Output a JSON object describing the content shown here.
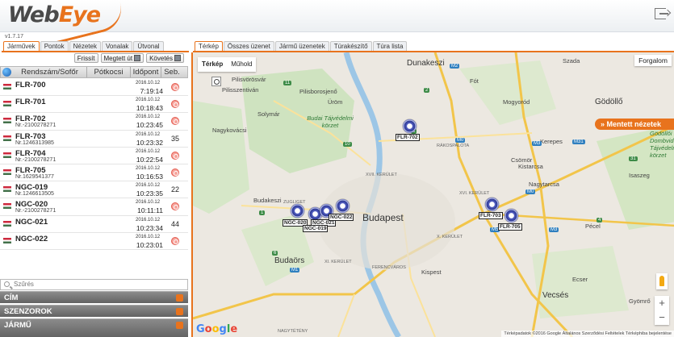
{
  "app": {
    "logo_web": "Web",
    "logo_eye": "Eye",
    "version": "v1.7.17"
  },
  "left_tabs": [
    "Járművek",
    "Pontok",
    "Nézetek",
    "Vonalak",
    "Útvonal"
  ],
  "toolbar": {
    "refresh": "Frissít",
    "route": "Megtett út",
    "follow": "Követés"
  },
  "table": {
    "headers": [
      "Rendszám/Sofőr",
      "Pótkocsi",
      "Időpont",
      "Seb."
    ],
    "rows": [
      {
        "plate": "FLR-700",
        "sub": "",
        "date": "2016.10.12",
        "time": "7:19:14",
        "speed": "",
        "stopped": true
      },
      {
        "plate": "FLR-701",
        "sub": "",
        "date": "2016.10.12",
        "time": "10:18:43",
        "speed": "",
        "stopped": true
      },
      {
        "plate": "FLR-702",
        "sub": "Nr.-2100278271",
        "date": "2016.10.12",
        "time": "10:23:45",
        "speed": "",
        "stopped": true
      },
      {
        "plate": "FLR-703",
        "sub": "Nr.1246313985",
        "date": "2016.10.12",
        "time": "10:23:32",
        "speed": "35",
        "stopped": false
      },
      {
        "plate": "FLR-704",
        "sub": "Nr.-2100278271",
        "date": "2016.10.12",
        "time": "10:22:54",
        "speed": "",
        "stopped": true
      },
      {
        "plate": "FLR-705",
        "sub": "Nr.1629541377",
        "date": "2016.10.12",
        "time": "10:16:53",
        "speed": "",
        "stopped": true
      },
      {
        "plate": "NGC-019",
        "sub": "Nr.1246613505",
        "date": "2016.10.12",
        "time": "10:23:35",
        "speed": "22",
        "stopped": false
      },
      {
        "plate": "NGC-020",
        "sub": "Nr.-2100278271",
        "date": "2016.10.12",
        "time": "10:11:11",
        "speed": "",
        "stopped": true
      },
      {
        "plate": "NGC-021",
        "sub": "",
        "date": "2016.10.12",
        "time": "10:23:34",
        "speed": "44",
        "stopped": false
      },
      {
        "plate": "NGC-022",
        "sub": "",
        "date": "2016.10.12",
        "time": "10:23:01",
        "speed": "",
        "stopped": true
      }
    ]
  },
  "filter": {
    "placeholder": "Szűrés"
  },
  "accordions": [
    "CÍM",
    "SZENZOROK",
    "JÁRMŰ"
  ],
  "right_tabs": [
    "Térkép",
    "Összes üzenet",
    "Jármű üzenetek",
    "Túrakészítő",
    "Túra lista"
  ],
  "map": {
    "type_map": "Térkép",
    "type_sat": "Műhold",
    "traffic": "Forgalom",
    "saved_views": "Mentett nézetek",
    "attribution": "Térképadatok ©2016 Google   Általános Szerződési Feltételek   Térképhiba bejelentése",
    "google": "Google",
    "places": [
      "Dunakeszi",
      "Fót",
      "Szada",
      "Gödöllő",
      "Mogyoród",
      "Pilisvörösvár",
      "Pilisszentiván",
      "Pilisborosjenő",
      "Üröm",
      "Solymár",
      "Budai Tájvédelmi körzet",
      "Nagykovácsi",
      "Kerepes",
      "Csömör",
      "Kistarcsa",
      "Nagytarcsa",
      "Isaszeg",
      "Budakeszi",
      "Budapest",
      "Pécel",
      "Budaörs",
      "Kispest",
      "Ecser",
      "Vecsés",
      "Gyömrő",
      "RÁKOSPALOTA",
      "XVII. KERÜLET",
      "XVI. KERÜLET",
      "X. KERÜLET",
      "XI. KERÜLET",
      "FERENCVÁROS",
      "ZUGLIGET",
      "NAGYTÉTÉNY",
      "Gödöllői Dombvidék Tájvédelmi körzet"
    ],
    "roads": [
      "M0",
      "M2",
      "M3",
      "M31",
      "M1",
      "M5",
      "M0",
      "10",
      "11",
      "2",
      "3",
      "4",
      "31",
      "M3",
      "1",
      "6"
    ],
    "vehicles": [
      "FLR-702",
      "NGC-020",
      "NGC-021",
      "NGC-022",
      "NGC-019",
      "FLR-703",
      "FLR-705"
    ]
  },
  "colors": {
    "accent": "#e8731d",
    "vehicle": "#3b46a8",
    "stop": "#e45c50"
  }
}
